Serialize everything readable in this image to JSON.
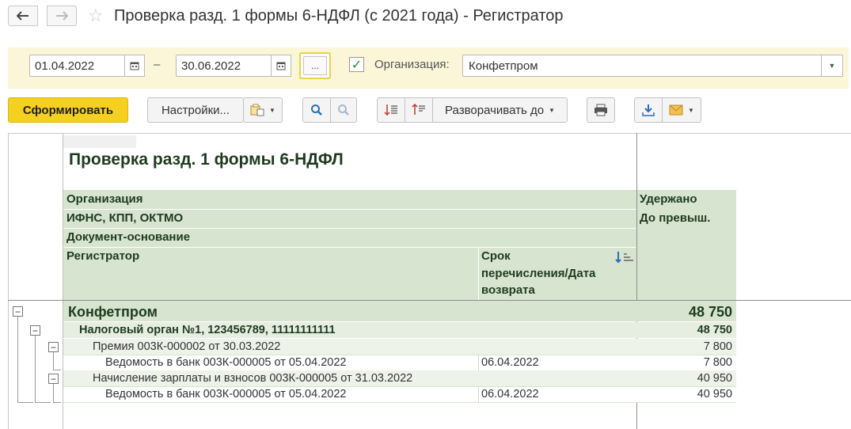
{
  "window": {
    "title": "Проверка разд. 1 формы 6-НДФЛ (с 2021 года) - Регистратор",
    "back_icon": "arrow-left-icon",
    "forward_icon": "arrow-right-icon",
    "favorite_icon": "star-icon"
  },
  "filter": {
    "date_from": "01.04.2022",
    "date_to": "30.06.2022",
    "dash": "–",
    "period_button": "...",
    "org_checked": true,
    "org_label": "Организация:",
    "org_value": "Конфетпром"
  },
  "toolbar": {
    "generate": "Сформировать",
    "settings": "Настройки...",
    "expand_to": "Разворачивать до"
  },
  "report": {
    "title": "Проверка разд. 1 формы 6-НДФЛ",
    "headers": {
      "organization": "Организация",
      "ifns": "ИФНС, КПП, ОКТМО",
      "document": "Документ-основание",
      "registrar": "Регистратор",
      "term_line1": "Срок",
      "term_line2": "перечисления/Дата",
      "term_line3": "возврата",
      "withheld": "Удержано",
      "before_exceed": "До превыш."
    },
    "rows": [
      {
        "label": "Конфетпром",
        "date": "",
        "value": "48 750"
      },
      {
        "label": "Налоговый орган №1, 123456789, 11111111111",
        "date": "",
        "value": "48 750"
      },
      {
        "label": "Премия 003К-000002 от 30.03.2022",
        "date": "",
        "value": "7 800"
      },
      {
        "label": "Ведомость в банк 003К-000005 от 05.04.2022",
        "date": "06.04.2022",
        "value": "7 800"
      },
      {
        "label": "Начисление зарплаты и взносов 003К-000005 от 31.03.2022",
        "date": "",
        "value": "40 950"
      },
      {
        "label": "Ведомость в банк 003К-000005 от 05.04.2022",
        "date": "06.04.2022",
        "value": "40 950"
      }
    ]
  },
  "colors": {
    "accent_yellow": "#f5d020",
    "filter_bg": "#fbf6d8",
    "header_green": "#d6e4d0",
    "group_green": "#e6eee2",
    "subgroup_green": "#eef3ea"
  }
}
